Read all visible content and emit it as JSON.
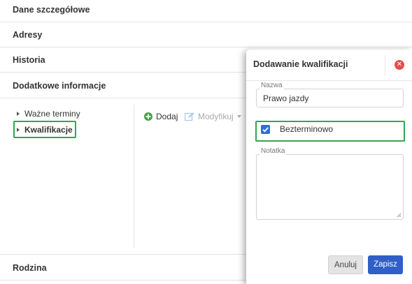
{
  "sections": {
    "details": "Dane szczegółowe",
    "addresses": "Adresy",
    "history": "Historia",
    "additional": "Dodatkowe informacje",
    "family": "Rodzina"
  },
  "tree": {
    "important_dates": "Ważne terminy",
    "qualifications": "Kwalifikacje"
  },
  "toolbar": {
    "add": "Dodaj",
    "modify": "Modyfikuj"
  },
  "modal": {
    "title": "Dodawanie kwalifikacji",
    "name_label": "Nazwa",
    "name_value": "Prawo jazdy",
    "checkbox_label": "Bezterminowo",
    "checkbox_checked": true,
    "note_label": "Notatka",
    "note_value": "",
    "cancel": "Anuluj",
    "save": "Zapisz"
  },
  "colors": {
    "highlight": "#2fa84f",
    "primary": "#2f5fc7",
    "danger": "#e74c4c",
    "add_icon": "#3aa64b"
  }
}
